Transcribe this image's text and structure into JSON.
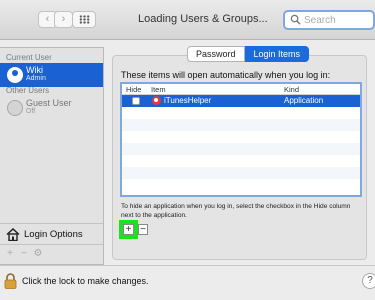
{
  "window": {
    "title": "Loading Users & Groups...",
    "search_placeholder": "Search",
    "nav_back": "‹",
    "nav_forward": "›"
  },
  "sidebar": {
    "current_user_label": "Current User",
    "current_user": {
      "name": "Wiki",
      "role": "Admin"
    },
    "other_users_label": "Other Users",
    "guest_user": {
      "name": "Guest User",
      "state": "Off"
    },
    "login_options_label": "Login Options",
    "toolbar": {
      "add": "+",
      "remove": "−",
      "gear": "⚙"
    }
  },
  "tabs": [
    {
      "label": "Password",
      "active": false
    },
    {
      "label": "Login Items",
      "active": true
    }
  ],
  "login_items": {
    "intro": "These items will open automatically when you log in:",
    "columns": {
      "hide": "Hide",
      "item": "Item",
      "kind": "Kind"
    },
    "rows": [
      {
        "hide": false,
        "item": "iTunesHelper",
        "kind": "Application",
        "selected": true
      }
    ],
    "hint": "To hide an application when you log in, select the checkbox in the Hide column next to the application.",
    "add_label": "+",
    "remove_label": "−"
  },
  "footer": {
    "lock_text": "Click the lock to make changes.",
    "help_label": "?"
  },
  "colors": {
    "selection": "#1a62d4",
    "highlight_green": "#1fe01f",
    "focus_ring": "#7ea8e0"
  }
}
